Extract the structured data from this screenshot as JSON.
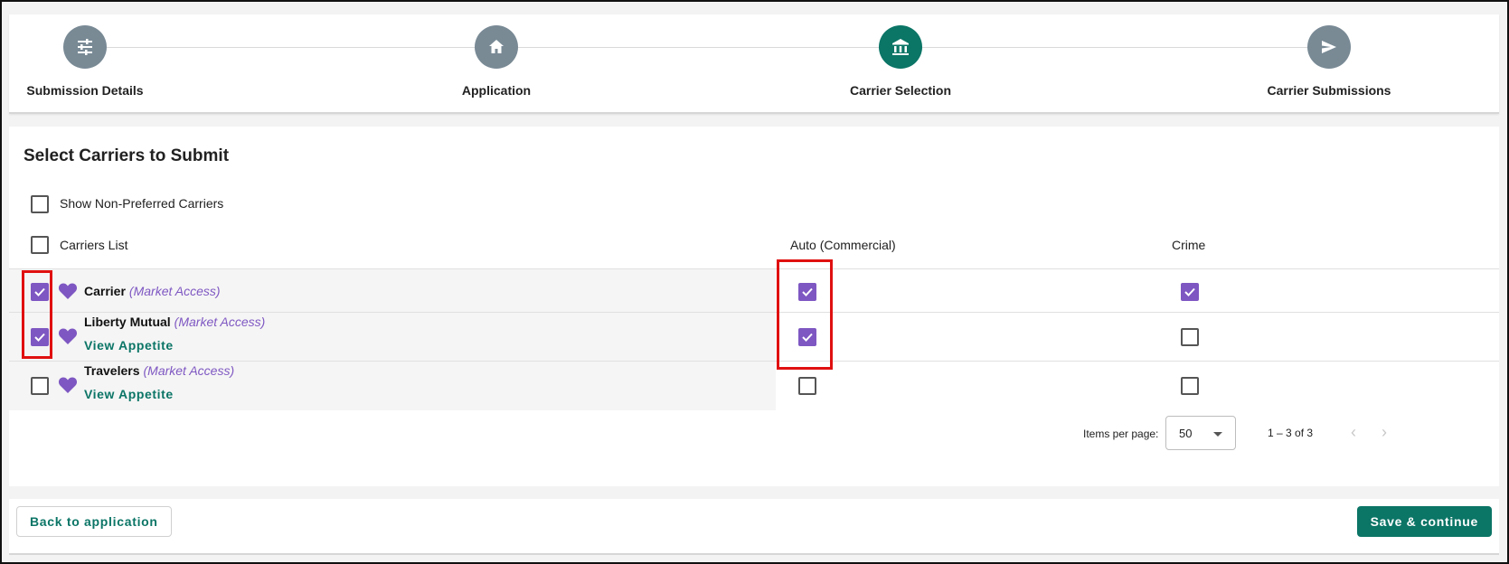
{
  "stepper": {
    "steps": [
      {
        "label": "Submission Details",
        "icon": "tune-icon",
        "active": false
      },
      {
        "label": "Application",
        "icon": "home-icon",
        "active": false
      },
      {
        "label": "Carrier Selection",
        "icon": "bank-icon",
        "active": true
      },
      {
        "label": "Carrier Submissions",
        "icon": "send-icon",
        "active": false
      }
    ]
  },
  "card": {
    "title": "Select Carriers to Submit",
    "show_non_preferred_label": "Show Non-Preferred Carriers",
    "show_non_preferred_checked": false,
    "columns": [
      "Carriers List",
      "Auto (Commercial)",
      "Crime"
    ],
    "rows": [
      {
        "name": "Carrier",
        "tag": "(Market Access)",
        "link": "",
        "selected": true,
        "auto": true,
        "crime": true
      },
      {
        "name": "Liberty Mutual",
        "tag": "(Market Access)",
        "link": "View Appetite",
        "selected": true,
        "auto": true,
        "crime": false
      },
      {
        "name": "Travelers",
        "tag": "(Market Access)",
        "link": "View Appetite",
        "selected": false,
        "auto": false,
        "crime": false
      }
    ]
  },
  "paginator": {
    "items_per_page_label": "Items per page:",
    "items_per_page": "50",
    "range": "1 – 3 of 3"
  },
  "footer": {
    "back_label": "Back to application",
    "save_label": "Save & continue"
  },
  "colors": {
    "accent": "#0b7566",
    "checkbox": "#7e57c2",
    "step_inactive": "#798a95",
    "highlight": "#e01010"
  }
}
